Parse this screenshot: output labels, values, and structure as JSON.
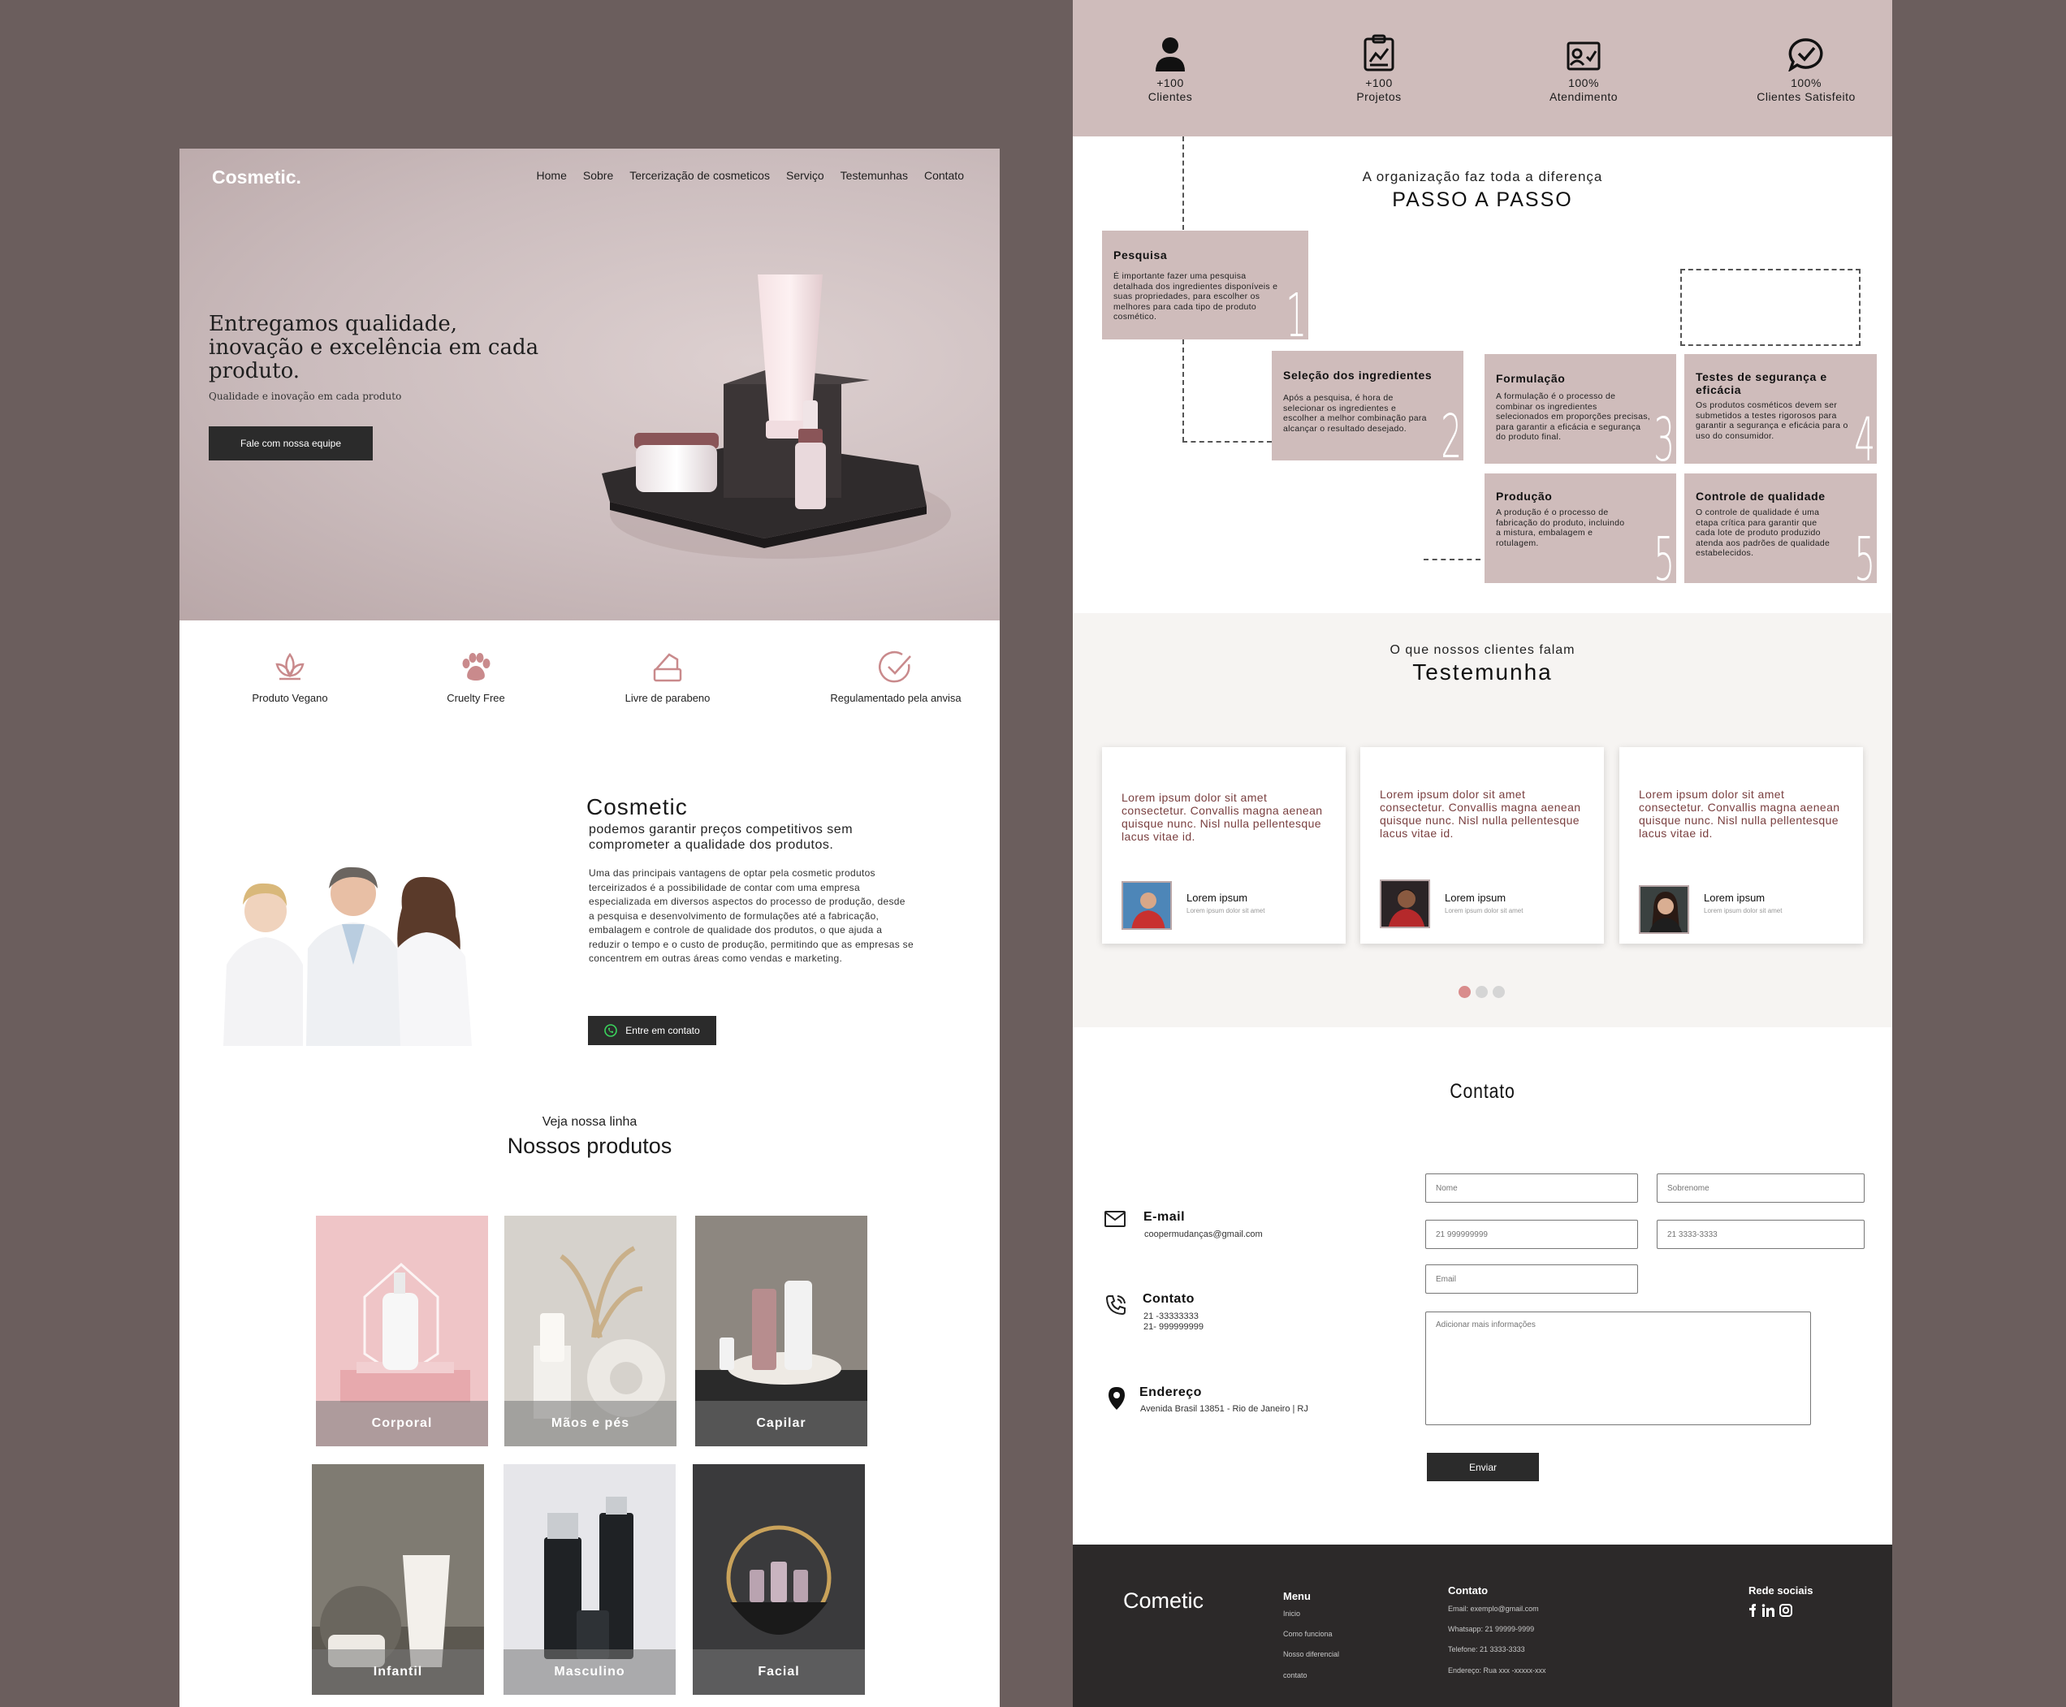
{
  "landing": {
    "logo": "Cosmetic.",
    "nav": [
      "Home",
      "Sobre",
      "Tercerização de cosmeticos",
      "Serviço",
      "Testemunhas",
      "Contato"
    ],
    "hero_title": "Entregamos qualidade, inovação e excelência em cada produto.",
    "hero_subtitle": "Qualidade e inovação em cada produto",
    "hero_button": "Fale com nossa equipe",
    "features": [
      {
        "icon": "lotus-icon",
        "label": "Produto Vegano"
      },
      {
        "icon": "paw-icon",
        "label": "Cruelty Free"
      },
      {
        "icon": "jar-icon",
        "label": "Livre de parabeno"
      },
      {
        "icon": "check-circle-icon",
        "label": "Regulamentado pela anvisa"
      }
    ],
    "about_title": "Cosmetic",
    "about_subtitle": "podemos garantir preços competitivos sem comprometer a qualidade dos produtos.",
    "about_body": "Uma das principais vantagens de optar pela cosmetic produtos terceirizados é a possibilidade de contar com uma empresa especializada em diversos aspectos do processo de produção, desde a pesquisa e desenvolvimento de formulações até a fabricação, embalagem e controle de qualidade dos produtos, o que ajuda a reduzir o tempo e o custo de produção, permitindo que as empresas se concentrem em outras áreas como vendas e marketing.",
    "about_button": "Entre em contato",
    "products_kicker": "Veja nossa linha",
    "products_title": "Nossos produtos",
    "products": [
      "Corporal",
      "Mãos e pés",
      "Capilar",
      "Infantil",
      "Masculino",
      "Facial"
    ]
  },
  "stats": [
    {
      "icon": "person-icon",
      "value": "+100",
      "label": "Clientes"
    },
    {
      "icon": "clipboard-chart-icon",
      "value": "+100",
      "label": "Projetos"
    },
    {
      "icon": "contact-card-icon",
      "value": "100%",
      "label": "Atendimento"
    },
    {
      "icon": "check-bubble-icon",
      "value": "100%",
      "label": "Clientes Satisfeito"
    }
  ],
  "process": {
    "kicker": "A organização faz toda a diferença",
    "title": "PASSO A PASSO",
    "steps": [
      {
        "title": "Pesquisa",
        "desc": "É importante fazer uma pesquisa detalhada dos ingredientes disponíveis e suas propriedades, para escolher os melhores para cada tipo de produto cosmético.",
        "num": "1"
      },
      {
        "title": "Seleção dos ingredientes",
        "desc": "Após a pesquisa, é hora de selecionar os ingredientes e escolher a melhor combinação para alcançar o resultado desejado.",
        "num": "2"
      },
      {
        "title": "Formulação",
        "desc": "A formulação é o processo de combinar os ingredientes selecionados em proporções precisas, para garantir a eficácia e segurança do produto final.",
        "num": "3"
      },
      {
        "title": "Testes de segurança e eficácia",
        "desc": "Os produtos cosméticos devem ser submetidos a testes rigorosos para garantir a segurança e eficácia para o uso do consumidor.",
        "num": "4"
      },
      {
        "title": "Produção",
        "desc": "A produção é o processo de fabricação do produto, incluindo a mistura, embalagem e rotulagem.",
        "num": "5"
      },
      {
        "title": "Controle de qualidade",
        "desc": "O controle de qualidade é uma etapa crítica para garantir que cada lote de produto produzido atenda aos padrões de qualidade estabelecidos.",
        "num": "5"
      }
    ]
  },
  "testimonials": {
    "kicker": "O que nossos clientes falam",
    "title": "Testemunha",
    "cards": [
      {
        "quote": "Lorem ipsum dolor sit amet consectetur. Convallis magna aenean quisque nunc. Nisl nulla pellentesque lacus vitae id.",
        "name": "Lorem  ipsum",
        "role": "Lorem ipsum dolor sit amet"
      },
      {
        "quote": "Lorem ipsum dolor sit amet consectetur. Convallis magna aenean quisque nunc. Nisl nulla pellentesque lacus vitae id.",
        "name": "Lorem  ipsum",
        "role": "Lorem ipsum dolor sit amet"
      },
      {
        "quote": "Lorem ipsum dolor sit amet consectetur. Convallis magna aenean quisque nunc. Nisl nulla pellentesque lacus vitae id.",
        "name": "Lorem  ipsum",
        "role": "Lorem ipsum dolor sit amet"
      }
    ]
  },
  "contact": {
    "title": "Contato",
    "email_label": "E-mail",
    "email_value": "coopermudanças@gmail.com",
    "phone_label": "Contato",
    "phone_1": "21 -33333333",
    "phone_2": "21- 999999999",
    "address_label": "Endereço",
    "address_value": "Avenida Brasil 13851 - Rio de Janeiro | RJ",
    "placeholders": {
      "nome": "Nome",
      "sobrenome": "Sobrenome",
      "tel1": "21 999999999",
      "tel2": "21 3333-3333",
      "email": "Email",
      "info": "Adicionar mais informações"
    },
    "submit": "Enviar"
  },
  "footer": {
    "logo": "Cometic",
    "menu_title": "Menu",
    "menu": [
      "Inicio",
      "Como funciona",
      "Nosso diferencial",
      "contato"
    ],
    "contact_title": "Contato",
    "contact_lines": [
      "Email: exemplo@gmail.com",
      "Whatsapp: 21 99999-9999",
      "Telefone: 21 3333-3333",
      "Endereço: Rua xxx -xxxxx-xxx"
    ],
    "social_title": "Rede sociais",
    "social": [
      "facebook-icon",
      "linkedin-icon",
      "instagram-icon"
    ]
  },
  "colors": {
    "background": "#6b5e5d",
    "accent_rose": "#cfbcbb",
    "dark": "#2b2b2b",
    "quote_text": "#7a4040",
    "dot_active": "#d98c8c"
  }
}
